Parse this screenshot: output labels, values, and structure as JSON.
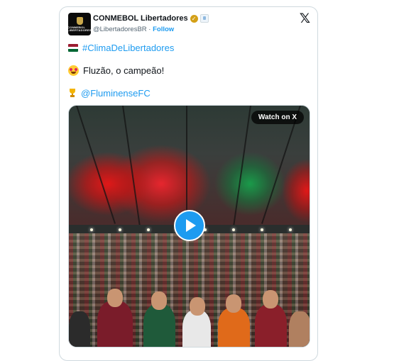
{
  "tweet": {
    "avatar_text": "CONMEBOL LIBERTADORES",
    "display_name": "CONMEBOL Libertadores",
    "handle": "@LibertadoresBR",
    "separator": "·",
    "follow_label": "Follow",
    "x_logo": "𝕏",
    "hashtag": "#ClimaDeLibertadores",
    "body_text": "Fluzão, o campeão!",
    "mention": "@FluminenseFC",
    "flag_colors": [
      "#9b1c31",
      "#ffffff",
      "#006633"
    ]
  },
  "media": {
    "watch_label": "Watch on X",
    "play_icon": "play-icon"
  },
  "colors": {
    "link": "#1d9bf0",
    "text": "#0f1419",
    "secondary": "#536471",
    "border": "#cfd9de"
  }
}
